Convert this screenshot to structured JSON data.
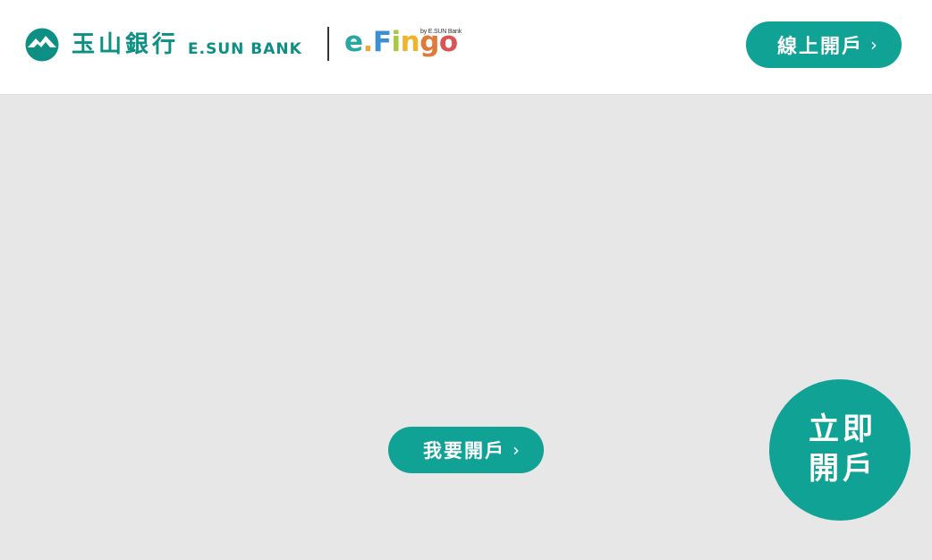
{
  "header": {
    "brand": {
      "name_zh": "玉山銀行",
      "name_en": "E.SUN BANK",
      "logo_icon": "esun-mountain-logo-icon"
    },
    "efingo": {
      "byline": "by E.SUN Bank",
      "word_parts": [
        "e",
        ".",
        "F",
        "i",
        "n",
        "g",
        "o"
      ]
    },
    "cta": {
      "label": "線上開戶",
      "chevron": "›"
    }
  },
  "main": {
    "open_account_button": {
      "label": "我要開戶",
      "chevron": "›"
    },
    "floating_button": {
      "line1": "立即",
      "line2": "開戶"
    }
  },
  "colors": {
    "brand_teal": "#0d8f84",
    "button_teal": "#11a296",
    "content_bg": "#e7e7e7",
    "header_bg": "#ffffff"
  }
}
